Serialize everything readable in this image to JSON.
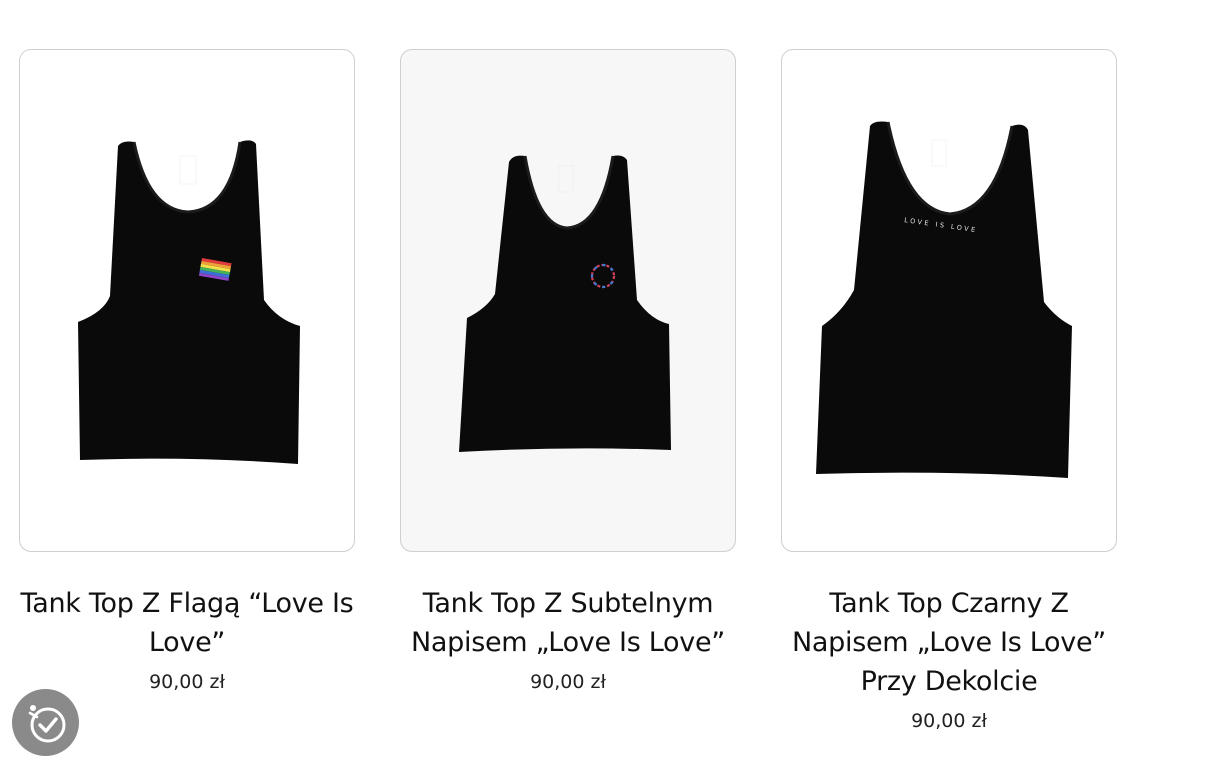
{
  "products": [
    {
      "title": "Tank Top Z Flagą “Love Is Love”",
      "price": "90,00 zł",
      "image_icon": "black-tank-top-rainbow-flag-image"
    },
    {
      "title": "Tank Top Z Subtelnym Napisem „Love Is Love”",
      "price": "90,00 zł",
      "image_icon": "black-tank-top-circle-print-image"
    },
    {
      "title": "Tank Top Czarny Z Napisem „Love Is Love” Przy Dekolcie",
      "price": "90,00 zł",
      "image_icon": "black-tank-top-neckline-print-image",
      "neck_print": "LOVE IS LOVE"
    }
  ],
  "accessibility_button": {
    "icon": "accessibility-icon"
  },
  "colors": {
    "garment": "#0a0a0a",
    "card_border": "#cfcfcf",
    "a11y_bg": "#8a8a8a"
  }
}
